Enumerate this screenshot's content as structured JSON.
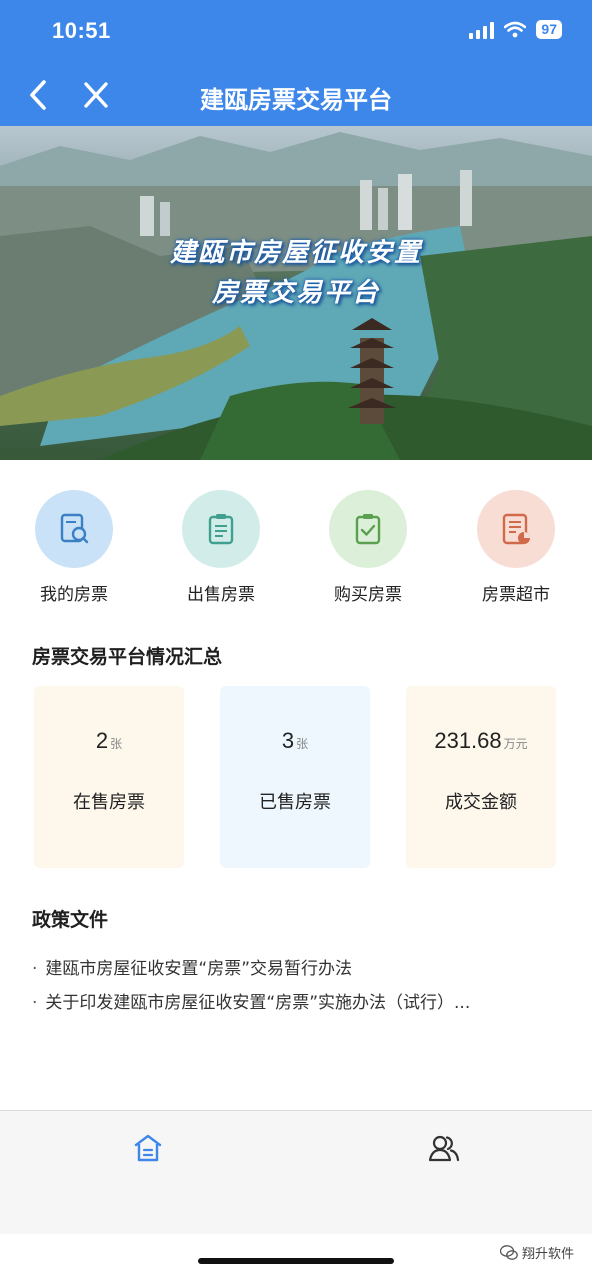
{
  "status_bar": {
    "time": "10:51",
    "battery": "97"
  },
  "nav": {
    "title": "建瓯房票交易平台"
  },
  "banner": {
    "line1": "建瓯市房屋征收安置",
    "line2": "房票交易平台"
  },
  "menu": [
    {
      "label": "我的房票",
      "icon": "ticket-search-icon",
      "bg": "#c9e2f7",
      "color": "#3b7fc4"
    },
    {
      "label": "出售房票",
      "icon": "clipboard-list-icon",
      "bg": "#d2ede9",
      "color": "#3fa08f"
    },
    {
      "label": "购买房票",
      "icon": "clipboard-check-icon",
      "bg": "#dcefd8",
      "color": "#5aa050"
    },
    {
      "label": "房票超市",
      "icon": "document-chart-icon",
      "bg": "#f7ddd3",
      "color": "#d06a4a"
    }
  ],
  "summary": {
    "title": "房票交易平台情况汇总",
    "cards": [
      {
        "value": "2",
        "unit": "张",
        "label": "在售房票",
        "bg": "#fdf7ec"
      },
      {
        "value": "3",
        "unit": "张",
        "label": "已售房票",
        "bg": "#eef7fd"
      },
      {
        "value": "231.68",
        "unit": "万元",
        "label": "成交金额",
        "bg": "#fdf7ec"
      }
    ]
  },
  "policy": {
    "title": "政策文件",
    "items": [
      "建瓯市房屋征收安置“房票”交易暂行办法",
      "关于印发建瓯市房屋征收安置“房票”实施办法（试行）..."
    ]
  },
  "tabbar": {
    "home_icon": "home-icon",
    "profile_icon": "users-icon"
  },
  "watermark": "翔升软件"
}
